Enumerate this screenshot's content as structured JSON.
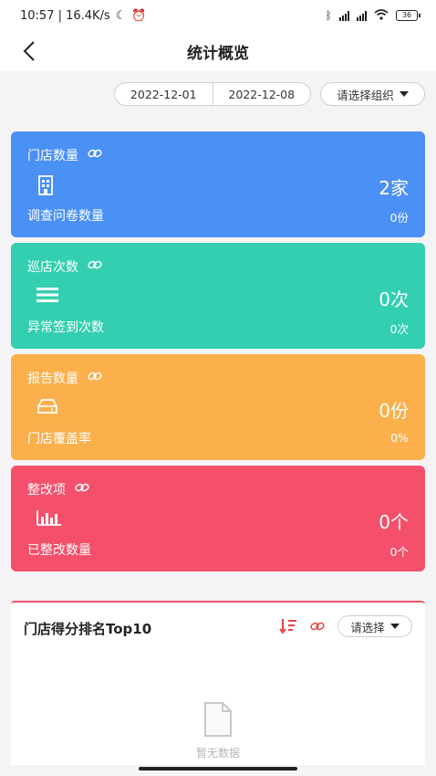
{
  "status_bar": {
    "time_speed": "10:57 | 16.4K/s",
    "battery": "36"
  },
  "header": {
    "title": "统计概览"
  },
  "filters": {
    "start_date": "2022-12-01",
    "end_date": "2022-12-08",
    "org_placeholder": "请选择组织"
  },
  "cards": [
    {
      "title": "门店数量",
      "value": "2家",
      "sub_label": "调查问卷数量",
      "sub_value": "0份",
      "color": "#4a90f5",
      "icon": "building-icon"
    },
    {
      "title": "巡店次数",
      "value": "0次",
      "sub_label": "异常签到次数",
      "sub_value": "0次",
      "color": "#33cfb0",
      "icon": "list-icon"
    },
    {
      "title": "报告数量",
      "value": "0份",
      "sub_label": "门店覆盖率",
      "sub_value": "0%",
      "color": "#fbb04c",
      "icon": "tray-icon"
    },
    {
      "title": "整改项",
      "value": "0个",
      "sub_label": "已整改数量",
      "sub_value": "0个",
      "color": "#f4506b",
      "icon": "bar-chart-icon"
    }
  ],
  "ranking": {
    "title": "门店得分排名Top10",
    "select_placeholder": "请选择",
    "empty_text": "暂无数据"
  }
}
